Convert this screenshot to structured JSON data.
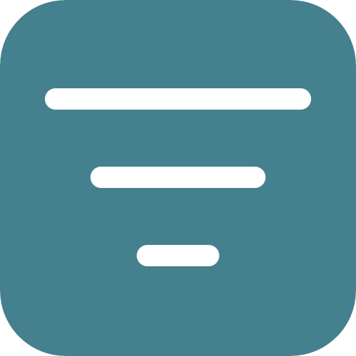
{
  "icon": {
    "name": "filter-icon",
    "background_color": "#44808d",
    "line_color": "#ffffff"
  }
}
